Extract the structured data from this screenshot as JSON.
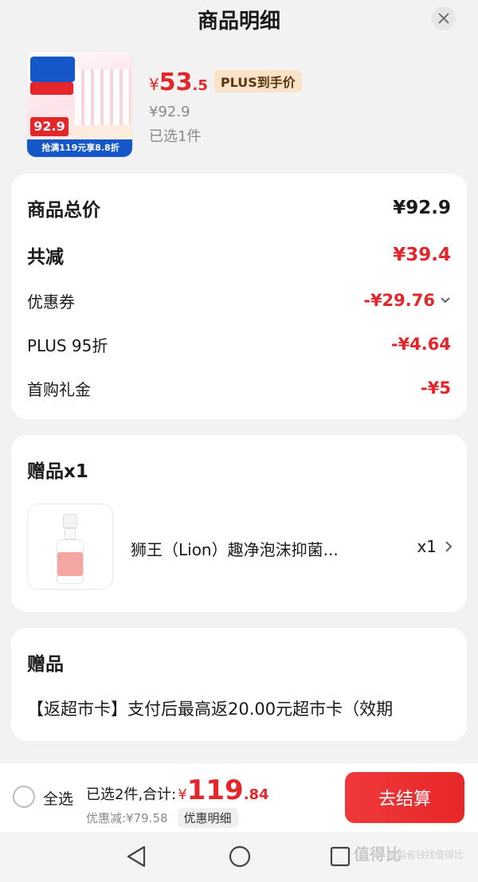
{
  "header": {
    "title": "商品明细"
  },
  "product": {
    "price_currency": "¥",
    "price_int": "53",
    "price_dec": ".5",
    "plus_tag": "PLUS到手价",
    "original_price": "¥92.9",
    "selected_qty": "已选1件",
    "thumb_badge": "92.9",
    "thumb_bar": "抢满119元享8.8折"
  },
  "summary": {
    "rows": [
      {
        "label": "商品总价",
        "value": "¥92.9"
      },
      {
        "label": "共减",
        "value": "¥39.4"
      },
      {
        "label": "优惠券",
        "value": "-¥29.76"
      },
      {
        "label": "PLUS 95折",
        "value": "-¥4.64"
      },
      {
        "label": "首购礼金",
        "value": "-¥5"
      }
    ]
  },
  "gift": {
    "title": "赠品x1",
    "name": "狮王（Lion）趣净泡沫抑菌...",
    "qty": "x1"
  },
  "gift_note": {
    "title": "赠品",
    "desc": "【返超市卡】支付后最高返20.00元超市卡（效期"
  },
  "bottom_bar": {
    "select_all": "全选",
    "summary_text": "已选2件,合计:",
    "total_currency": "¥",
    "total_int": "119",
    "total_dec": ".84",
    "discount_text": "优惠减:¥79.58",
    "detail_button": "优惠明细",
    "checkout_button": "去结算"
  },
  "watermark": {
    "text": "值得比",
    "sub": "网购省钱找值得比"
  },
  "colors": {
    "accent": "#e4262b",
    "plus_tag_bg": "#fbe3c8"
  }
}
